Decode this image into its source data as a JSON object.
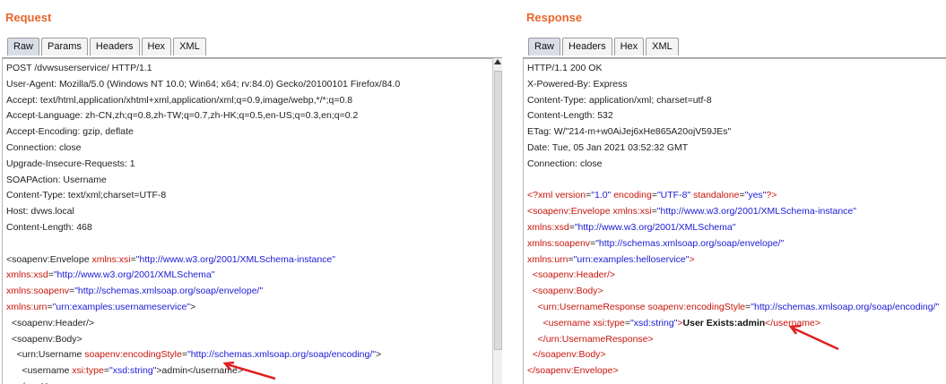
{
  "request": {
    "title": "Request",
    "tabs": [
      "Raw",
      "Params",
      "Headers",
      "Hex",
      "XML"
    ],
    "active_tab": "Raw",
    "lines": [
      [
        {
          "t": "POST /dvwsuserservice/ HTTP/1.1",
          "c": "t"
        }
      ],
      [
        {
          "t": "User-Agent: Mozilla/5.0 (Windows NT 10.0; Win64; x64; rv:84.0) Gecko/20100101 Firefox/84.0",
          "c": "t"
        }
      ],
      [
        {
          "t": "Accept: text/html,application/xhtml+xml,application/xml;q=0.9,image/webp,*/*;q=0.8",
          "c": "t"
        }
      ],
      [
        {
          "t": "Accept-Language: zh-CN,zh;q=0.8,zh-TW;q=0.7,zh-HK;q=0.5,en-US;q=0.3,en;q=0.2",
          "c": "t"
        }
      ],
      [
        {
          "t": "Accept-Encoding: gzip, deflate",
          "c": "t"
        }
      ],
      [
        {
          "t": "Connection: close",
          "c": "t"
        }
      ],
      [
        {
          "t": "Upgrade-Insecure-Requests: 1",
          "c": "t"
        }
      ],
      [
        {
          "t": "SOAPAction: Username",
          "c": "t"
        }
      ],
      [
        {
          "t": "Content-Type: text/xml;charset=UTF-8",
          "c": "t"
        }
      ],
      [
        {
          "t": "Host: dvws.local",
          "c": "t"
        }
      ],
      [
        {
          "t": "Content-Length: 468",
          "c": "t"
        }
      ],
      [
        {
          "t": "",
          "c": "t"
        }
      ],
      [
        {
          "t": "<soapenv:Envelope ",
          "c": "t"
        },
        {
          "t": "xmlns:xsi",
          "c": "red"
        },
        {
          "t": "=",
          "c": "t"
        },
        {
          "t": "\"http://www.w3.org/2001/XMLSchema-instance\"",
          "c": "blue"
        }
      ],
      [
        {
          "t": "xmlns:xsd",
          "c": "red"
        },
        {
          "t": "=",
          "c": "t"
        },
        {
          "t": "\"http://www.w3.org/2001/XMLSchema\"",
          "c": "blue"
        }
      ],
      [
        {
          "t": "xmlns:soapenv",
          "c": "red"
        },
        {
          "t": "=",
          "c": "t"
        },
        {
          "t": "\"http://schemas.xmlsoap.org/soap/envelope/\"",
          "c": "blue"
        }
      ],
      [
        {
          "t": "xmlns:urn",
          "c": "red"
        },
        {
          "t": "=",
          "c": "t"
        },
        {
          "t": "\"urn:examples:usernameservice\"",
          "c": "blue"
        },
        {
          "t": ">",
          "c": "t"
        }
      ],
      [
        {
          "t": "  <soapenv:Header/>",
          "c": "t"
        }
      ],
      [
        {
          "t": "  <soapenv:Body>",
          "c": "t"
        }
      ],
      [
        {
          "t": "    <urn:Username ",
          "c": "t"
        },
        {
          "t": "soapenv:encodingStyle",
          "c": "red"
        },
        {
          "t": "=",
          "c": "t"
        },
        {
          "t": "\"http://schemas.xmlsoap.org/soap/encoding/\"",
          "c": "blue"
        },
        {
          "t": ">",
          "c": "t"
        }
      ],
      [
        {
          "t": "      <username ",
          "c": "t"
        },
        {
          "t": "xsi:type",
          "c": "red"
        },
        {
          "t": "=",
          "c": "t"
        },
        {
          "t": "\"xsd:string\"",
          "c": "blue"
        },
        {
          "t": ">admin</username>",
          "c": "t"
        }
      ],
      [
        {
          "t": "    </urn:Username>",
          "c": "t"
        }
      ]
    ]
  },
  "response": {
    "title": "Response",
    "tabs": [
      "Raw",
      "Headers",
      "Hex",
      "XML"
    ],
    "active_tab": "Raw",
    "lines": [
      [
        {
          "t": "HTTP/1.1 200 OK",
          "c": "t"
        }
      ],
      [
        {
          "t": "X-Powered-By: Express",
          "c": "t"
        }
      ],
      [
        {
          "t": "Content-Type: application/xml; charset=utf-8",
          "c": "t"
        }
      ],
      [
        {
          "t": "Content-Length: 532",
          "c": "t"
        }
      ],
      [
        {
          "t": "ETag: W/\"214-m+w0AiJej6xHe865A20ojV59JEs\"",
          "c": "t"
        }
      ],
      [
        {
          "t": "Date: Tue, 05 Jan 2021 03:52:32 GMT",
          "c": "t"
        }
      ],
      [
        {
          "t": "Connection: close",
          "c": "t"
        }
      ],
      [
        {
          "t": "",
          "c": "t"
        }
      ],
      [
        {
          "t": "<?xml ",
          "c": "red"
        },
        {
          "t": "version",
          "c": "red"
        },
        {
          "t": "=",
          "c": "t"
        },
        {
          "t": "\"1.0\" ",
          "c": "blue"
        },
        {
          "t": "encoding",
          "c": "red"
        },
        {
          "t": "=",
          "c": "t"
        },
        {
          "t": "\"UTF-8\" ",
          "c": "blue"
        },
        {
          "t": "standalone",
          "c": "red"
        },
        {
          "t": "=",
          "c": "t"
        },
        {
          "t": "\"yes\"",
          "c": "blue"
        },
        {
          "t": "?>",
          "c": "red"
        }
      ],
      [
        {
          "t": "<soapenv:Envelope ",
          "c": "red"
        },
        {
          "t": "xmlns:xsi",
          "c": "red"
        },
        {
          "t": "=",
          "c": "t"
        },
        {
          "t": "\"http://www.w3.org/2001/XMLSchema-instance\"",
          "c": "blue"
        }
      ],
      [
        {
          "t": "xmlns:xsd",
          "c": "red"
        },
        {
          "t": "=",
          "c": "t"
        },
        {
          "t": "\"http://www.w3.org/2001/XMLSchema\"",
          "c": "blue"
        }
      ],
      [
        {
          "t": "xmlns:soapenv",
          "c": "red"
        },
        {
          "t": "=",
          "c": "t"
        },
        {
          "t": "\"http://schemas.xmlsoap.org/soap/envelope/\"",
          "c": "blue"
        }
      ],
      [
        {
          "t": "xmlns:urn",
          "c": "red"
        },
        {
          "t": "=",
          "c": "t"
        },
        {
          "t": "\"urn:examples:helloservice\"",
          "c": "blue"
        },
        {
          "t": ">",
          "c": "red"
        }
      ],
      [
        {
          "t": "  <soapenv:Header/>",
          "c": "red"
        }
      ],
      [
        {
          "t": "  <soapenv:Body>",
          "c": "red"
        }
      ],
      [
        {
          "t": "    <urn:UsernameResponse ",
          "c": "red"
        },
        {
          "t": "soapenv:encodingStyle",
          "c": "red"
        },
        {
          "t": "=",
          "c": "t"
        },
        {
          "t": "\"http://schemas.xmlsoap.org/soap/encoding/\"",
          "c": "blue"
        }
      ],
      [
        {
          "t": "      <username ",
          "c": "red"
        },
        {
          "t": "xsi:type",
          "c": "red"
        },
        {
          "t": "=",
          "c": "t"
        },
        {
          "t": "\"xsd:string\"",
          "c": "blue"
        },
        {
          "t": ">",
          "c": "red"
        },
        {
          "t": "User Exists:admin",
          "c": "bold"
        },
        {
          "t": "</username>",
          "c": "red"
        }
      ],
      [
        {
          "t": "    </urn:UsernameResponse>",
          "c": "red"
        }
      ],
      [
        {
          "t": "  </soapenv:Body>",
          "c": "red"
        }
      ],
      [
        {
          "t": "</soapenv:Envelope>",
          "c": "red"
        }
      ]
    ]
  },
  "colors": {
    "title": "#e8662b",
    "attr_name": "#c8140a",
    "attr_value": "#1a1ad6",
    "annotation_arrow": "#e02020"
  }
}
